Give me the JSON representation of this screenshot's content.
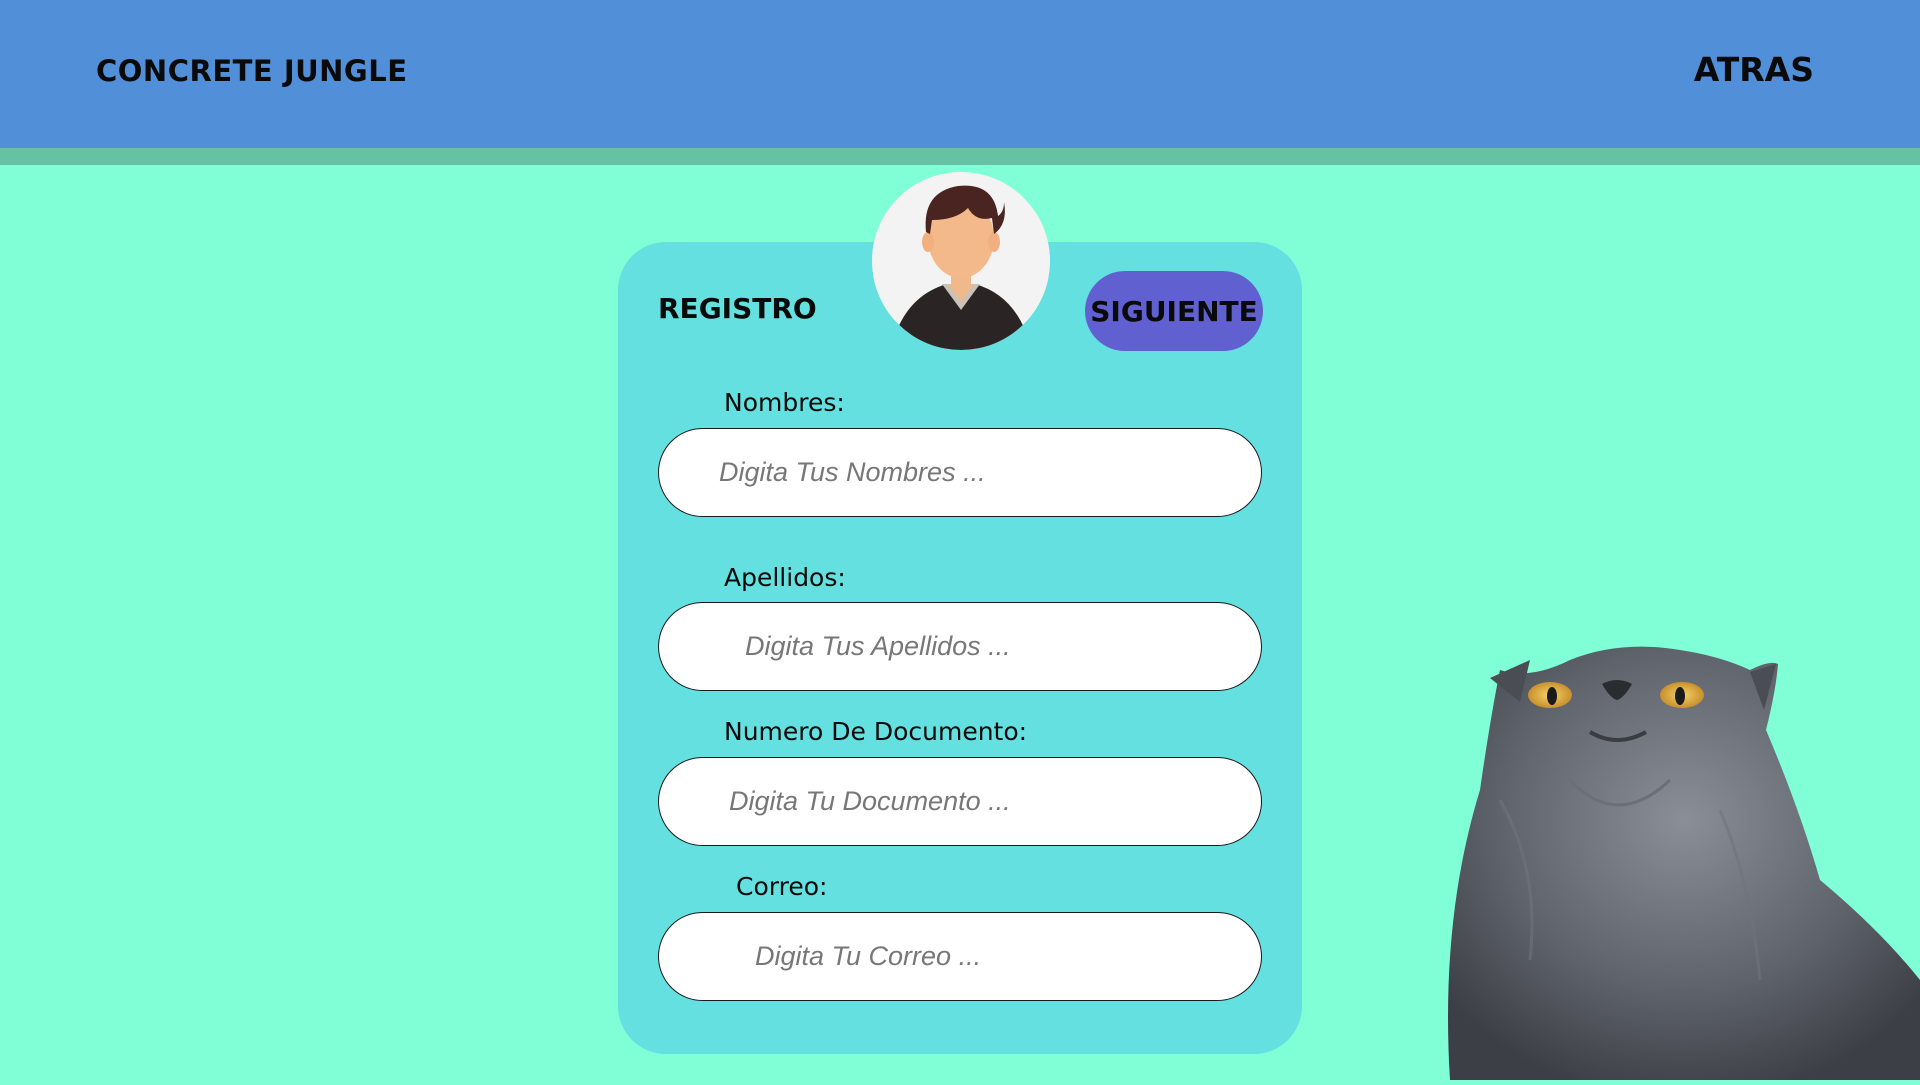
{
  "header": {
    "brand": "CONCRETE JUNGLE",
    "back_label": "ATRAS"
  },
  "form": {
    "title": "REGISTRO",
    "next_label": "SIGUIENTE",
    "fields": [
      {
        "label": "Nombres:",
        "placeholder": "Digita Tus Nombres ..."
      },
      {
        "label": "Apellidos:",
        "placeholder": "Digita Tus Apellidos ..."
      },
      {
        "label": "Numero De Documento:",
        "placeholder": "Digita Tu Documento ..."
      },
      {
        "label": "Correo:",
        "placeholder": "Digita Tu Correo ..."
      }
    ]
  },
  "icons": {
    "avatar": "user-avatar-icon",
    "decoration": "cat-photo"
  },
  "colors": {
    "header": "#528fd9",
    "header_stripe": "#66c2a3",
    "background": "#80ffd6",
    "card": "#63e0df",
    "button": "#6160d0",
    "input": "#ffffff"
  }
}
